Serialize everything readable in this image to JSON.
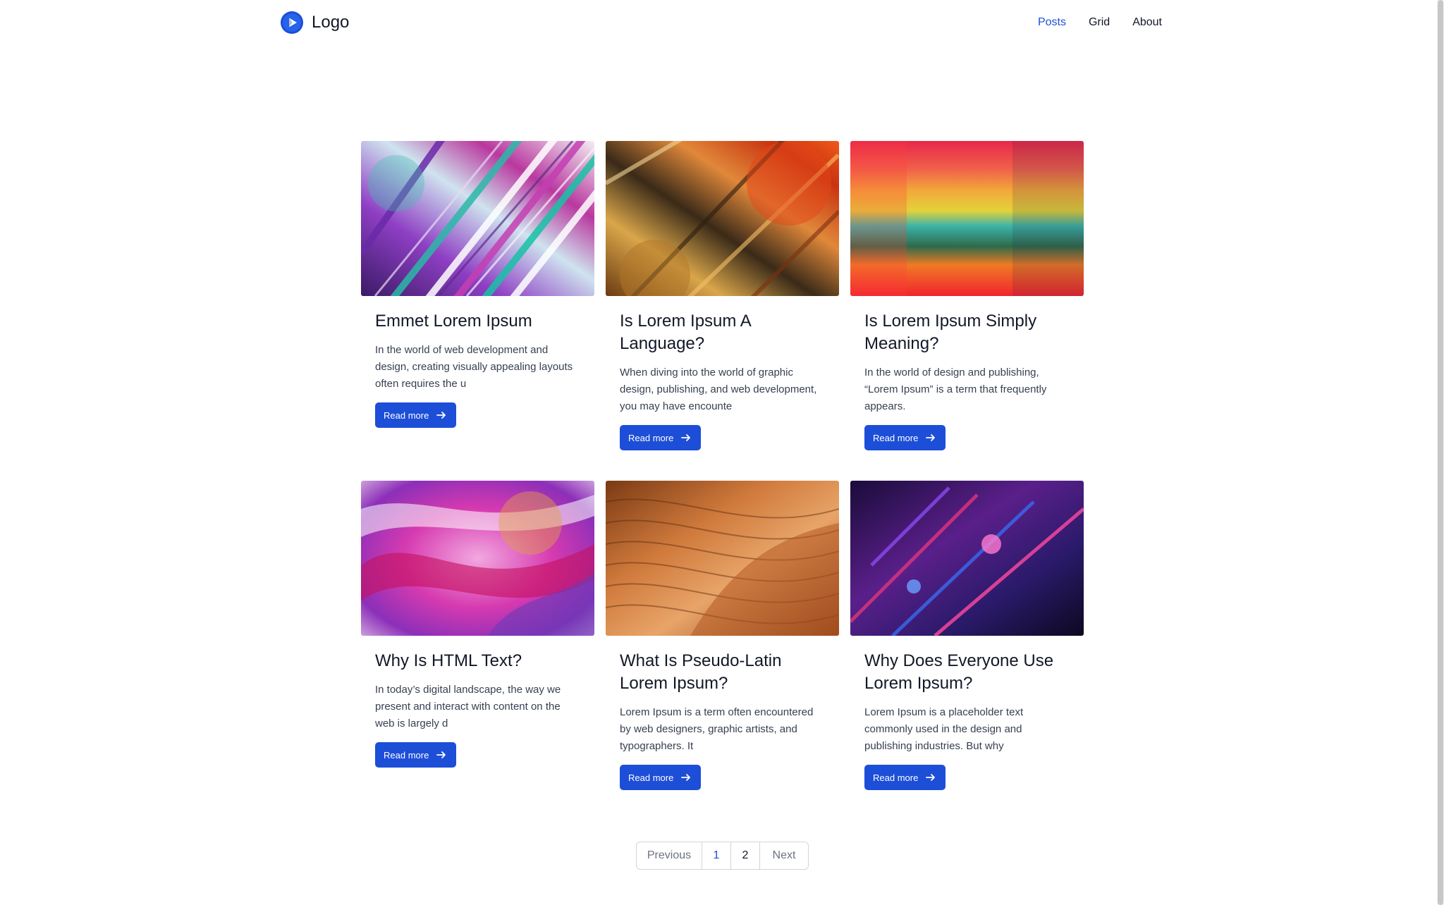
{
  "header": {
    "logo_text": "Logo",
    "nav": [
      {
        "label": "Posts",
        "active": true
      },
      {
        "label": "Grid",
        "active": false
      },
      {
        "label": "About",
        "active": false
      }
    ]
  },
  "colors": {
    "accent": "#1d4ed8",
    "text": "#111827",
    "muted": "#6b7280"
  },
  "posts": [
    {
      "title": "Emmet Lorem Ipsum",
      "excerpt": "In the world of web development and design, creating visually appealing layouts often requires the u",
      "cta": "Read more",
      "image": "marble-swirl-purple-teal"
    },
    {
      "title": "Is Lorem Ipsum A Language?",
      "excerpt": "When diving into the world of graphic design, publishing, and web development, you may have encounte",
      "cta": "Read more",
      "image": "cracked-gold-orange-texture"
    },
    {
      "title": "Is Lorem Ipsum Simply Meaning?",
      "excerpt": "In the world of design and publishing, “Lorem Ipsum” is a term that frequently appears.",
      "cta": "Read more",
      "image": "blurred-rainbow-stripes"
    },
    {
      "title": "Why Is HTML Text?",
      "excerpt": "In today’s digital landscape, the way we present and interact with content on the web is largely d",
      "cta": "Read more",
      "image": "pink-fluid-paint"
    },
    {
      "title": "What Is Pseudo-Latin Lorem Ipsum?",
      "excerpt": "Lorem Ipsum is a term often encountered by web designers, graphic artists, and typographers. It",
      "cta": "Read more",
      "image": "sandstone-waves"
    },
    {
      "title": "Why Does Everyone Use Lorem Ipsum?",
      "excerpt": "Lorem Ipsum is a placeholder text commonly used in the design and publishing industries. But why",
      "cta": "Read more",
      "image": "neon-crystal-abstract"
    }
  ],
  "pagination": {
    "previous": "Previous",
    "pages": [
      "1",
      "2"
    ],
    "current_page": "1",
    "next": "Next"
  }
}
